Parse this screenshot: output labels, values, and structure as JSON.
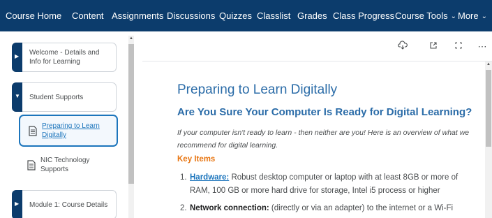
{
  "topnav": {
    "items": [
      {
        "label": "Course Home"
      },
      {
        "label": "Content"
      },
      {
        "label": "Assignments"
      },
      {
        "label": "Discussions"
      },
      {
        "label": "Quizzes"
      },
      {
        "label": "Classlist"
      },
      {
        "label": "Grades"
      },
      {
        "label": "Class Progress"
      },
      {
        "label": "Course Tools"
      },
      {
        "label": "More"
      }
    ],
    "background": "#0c3c6c"
  },
  "sidebar": {
    "modules": [
      {
        "label": "Welcome - Details and Info for Learning",
        "state": "collapsed"
      },
      {
        "label": "Student Supports",
        "state": "expanded"
      },
      {
        "label": "Module 1: Course Details",
        "state": "collapsed"
      }
    ],
    "topics": [
      {
        "label": "Preparing to Learn Digitally",
        "active": true
      },
      {
        "label": "NIC Technology Supports",
        "active": false
      }
    ]
  },
  "toolbar": {
    "icons": [
      "download-icon",
      "open-new-window-icon",
      "fullscreen-icon",
      "more-options-icon"
    ]
  },
  "content": {
    "title": "Preparing to Learn Digitally",
    "subtitle": "Are You Sure Your Computer Is Ready for Digital Learning?",
    "intro": "If your computer isn't ready to learn - then neither are you! Here is an overview of what we recommend for digital learning.",
    "key_items_heading": "Key Items",
    "items": [
      {
        "num": "1.",
        "lead": "Hardware:",
        "text": " Robust desktop computer or laptop with at least 8GB or more of RAM, 100 GB or more hard drive for storage, Intel i5 process or higher"
      },
      {
        "num": "2.",
        "lead": "Network connection:",
        "text": " (directly or via an adapter) to the internet or a Wi-Fi"
      }
    ]
  },
  "colors": {
    "heading": "#2b6ca8",
    "accent": "#e87511",
    "link": "#1c75bc"
  }
}
